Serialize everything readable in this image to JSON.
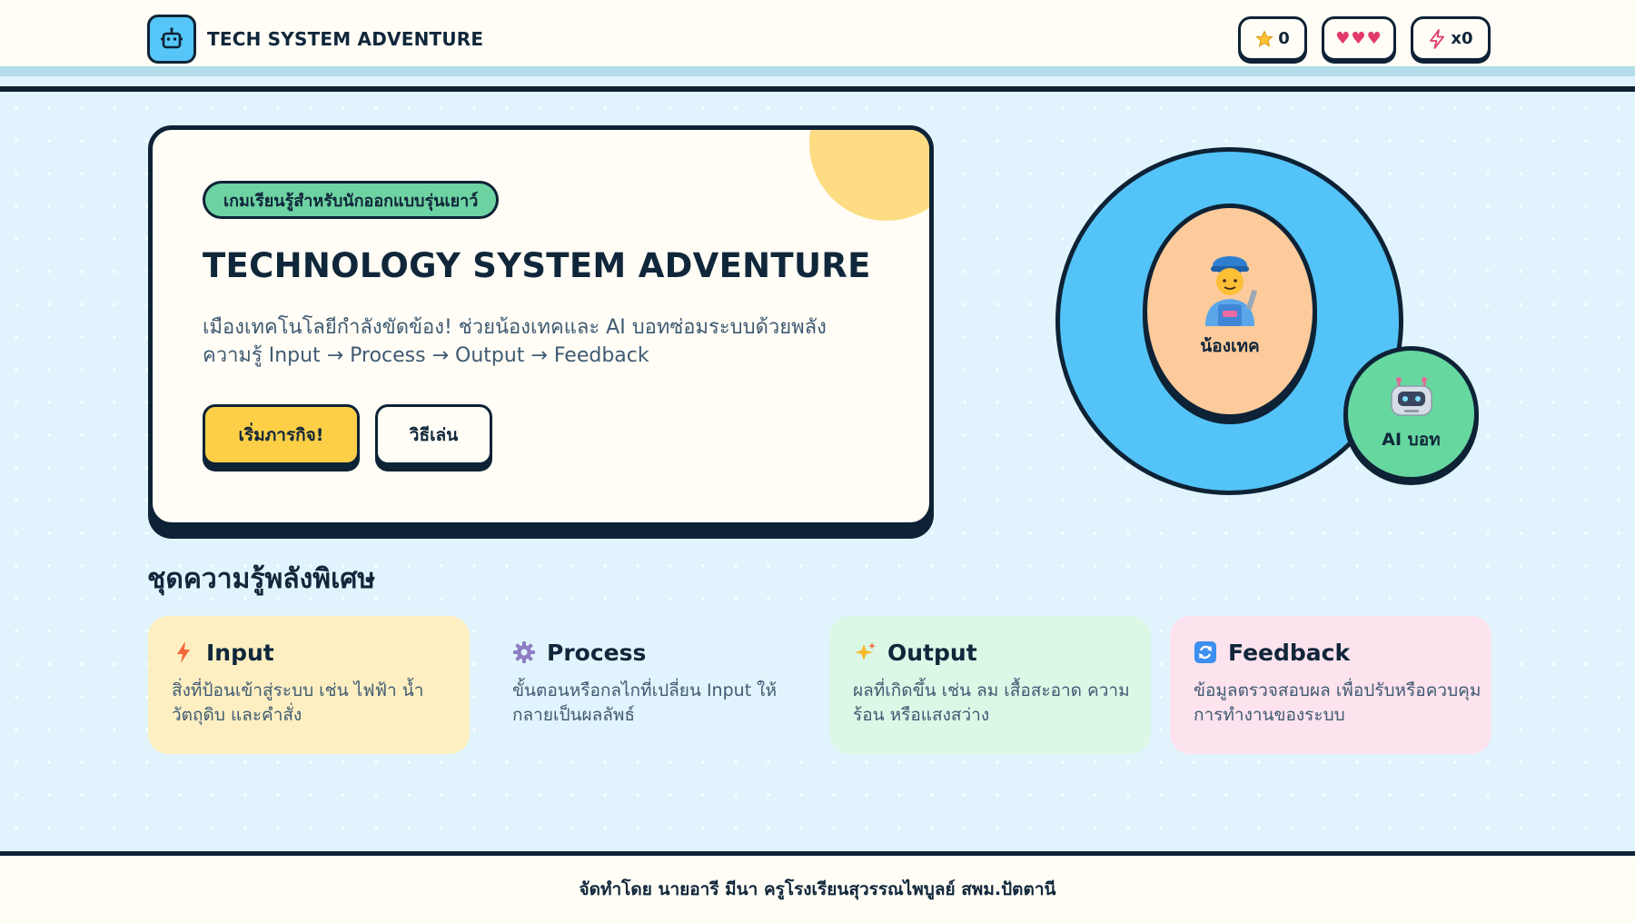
{
  "header": {
    "title": "TECH SYSTEM ADVENTURE",
    "logo_icon": "robot-icon",
    "stats": {
      "score": "0",
      "score_icon": "star-icon",
      "lives": "♥♥♥",
      "lives_count": 3,
      "lives_icon": "heart-icon",
      "combo": "x0",
      "combo_icon": "lightning-icon"
    }
  },
  "hero": {
    "badge": "เกมเรียนรู้สำหรับนักออกแบบรุ่นเยาว์",
    "title": "TECHNOLOGY SYSTEM ADVENTURE",
    "description": "เมืองเทคโนโลยีกำลังขัดข้อง! ช่วยน้องเทคและ AI บอทซ่อมระบบด้วยพลังความรู้ Input → Process → Output → Feedback",
    "start_button": "เริ่มภารกิจ!",
    "howto_button": "วิธีเล่น"
  },
  "characters": {
    "mechanic_name": "น้องเทค",
    "mechanic_icon": "mechanic-icon",
    "bot_name": "AI บอท",
    "bot_icon": "robot-icon"
  },
  "knowledge": {
    "title": "ชุดความรู้พลังพิเศษ",
    "cards": [
      {
        "icon": "lightning-icon",
        "title": "Input",
        "desc": "สิ่งที่ป้อนเข้าสู่ระบบ เช่น ไฟฟ้า น้ำ วัตถุดิบ และคำสั่ง"
      },
      {
        "icon": "gear-icon",
        "title": "Process",
        "desc": "ขั้นตอนหรือกลไกที่เปลี่ยน Input ให้กลายเป็นผลลัพธ์"
      },
      {
        "icon": "sparkles-icon",
        "title": "Output",
        "desc": "ผลที่เกิดขึ้น เช่น ลม เสื้อสะอาด ความร้อน หรือแสงสว่าง"
      },
      {
        "icon": "refresh-icon",
        "title": "Feedback",
        "desc": "ข้อมูลตรวจสอบผล เพื่อปรับหรือควบคุมการทำงานของระบบ"
      }
    ]
  },
  "footer": {
    "credit": "จัดทำโดย นายอารี มีนา ครูโรงเรียนสุวรรณไพบูลย์ สพม.ปัตตานี"
  },
  "colors": {
    "ink": "#0e2236",
    "accent_yellow": "#fccf47",
    "accent_blue": "#54c4f8",
    "accent_green": "#6ed3a2",
    "heart": "#e23b6a"
  }
}
